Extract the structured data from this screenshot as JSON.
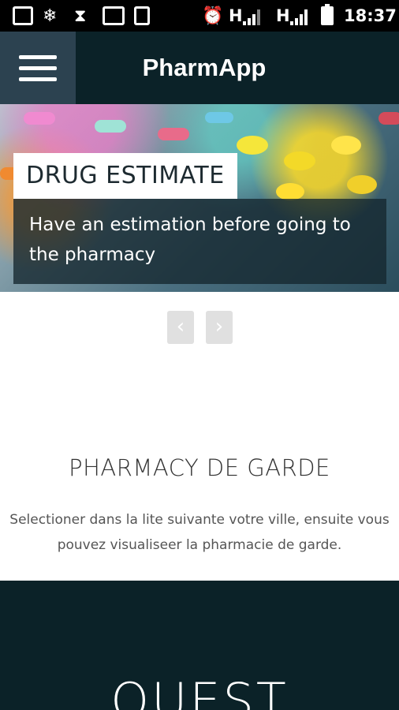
{
  "status_bar": {
    "time": "18:37",
    "network_1": "H",
    "network_2": "H"
  },
  "header": {
    "title": "PharmApp",
    "menu_icon": "hamburger-menu-icon"
  },
  "hero": {
    "title": "DRUG ESTIMATE",
    "description": "Have an estimation before going to the pharmacy"
  },
  "carousel": {
    "prev_label": "‹",
    "next_label": "›"
  },
  "pharmacy_section": {
    "title": "PHARMACY DE GARDE",
    "description": "Selectioner dans la lite suivante votre ville, ensuite vous pouvez visualiseer la pharmacie de garde."
  },
  "bottom_section": {
    "title": "OUEST"
  },
  "colors": {
    "header_bg": "#0b2228",
    "menu_bg": "#2c4250",
    "nav_btn_bg": "#e0e0e0"
  }
}
